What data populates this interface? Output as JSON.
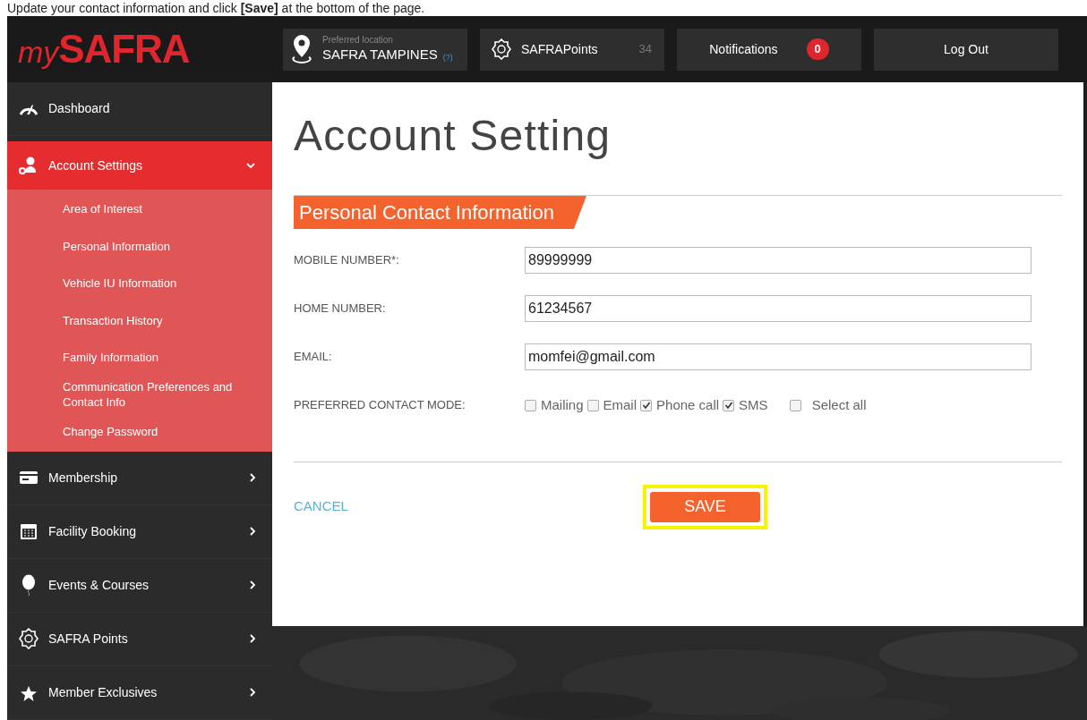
{
  "instruction": "Update your contact information and click **[Save]** at the bottom of the page.",
  "header": {
    "logo_prefix": "my",
    "logo_main": "SAFRA",
    "location_caption": "Preferred location",
    "location": "SAFRA TAMPINES",
    "location_help": "(?)",
    "points_label": "SAFRAPoints",
    "points_value": "34",
    "notifications_label": "Notifications",
    "notifications_count": "0",
    "logout": "Log Out"
  },
  "sidebar": {
    "items": [
      {
        "label": "Dashboard",
        "kind": "gauge",
        "expanded": false,
        "selected": false,
        "arrow": false
      },
      {
        "label": "Account Settings",
        "kind": "user",
        "expanded": true,
        "selected": true,
        "arrow": true,
        "children": [
          {
            "label": "Area of Interest"
          },
          {
            "label": "Personal Information"
          },
          {
            "label": "Vehicle IU Information"
          },
          {
            "label": "Transaction History"
          },
          {
            "label": "Family Information"
          },
          {
            "label": "Communication Preferences and Contact Info"
          },
          {
            "label": "Change Password"
          }
        ]
      },
      {
        "label": "Membership",
        "kind": "card",
        "expanded": false,
        "selected": false,
        "arrow": true
      },
      {
        "label": "Facility Booking",
        "kind": "calendar",
        "expanded": false,
        "selected": false,
        "arrow": true
      },
      {
        "label": "Events & Courses",
        "kind": "balloon",
        "expanded": false,
        "selected": false,
        "arrow": true
      },
      {
        "label": "SAFRA Points",
        "kind": "badge",
        "expanded": false,
        "selected": false,
        "arrow": true
      },
      {
        "label": "Member Exclusives",
        "kind": "star",
        "expanded": false,
        "selected": false,
        "arrow": true
      }
    ]
  },
  "page": {
    "title": "Account Setting",
    "section": "Personal Contact Information",
    "fields": [
      {
        "label": "MOBILE NUMBER*:",
        "value": "89999999"
      },
      {
        "label": "HOME NUMBER:",
        "value": "61234567"
      },
      {
        "label": "EMAIL:",
        "value": "momfei@gmail.com"
      }
    ],
    "contact_mode": {
      "label": "PREFERRED CONTACT MODE:",
      "options": [
        {
          "label": "Mailing",
          "checked": false
        },
        {
          "label": "Email",
          "checked": false
        },
        {
          "label": "Phone call",
          "checked": true
        },
        {
          "label": "SMS",
          "checked": true
        }
      ],
      "select_all": {
        "label": "Select all",
        "checked": false
      }
    },
    "cancel": "CANCEL",
    "save": "SAVE",
    "save_highlighted": true
  }
}
